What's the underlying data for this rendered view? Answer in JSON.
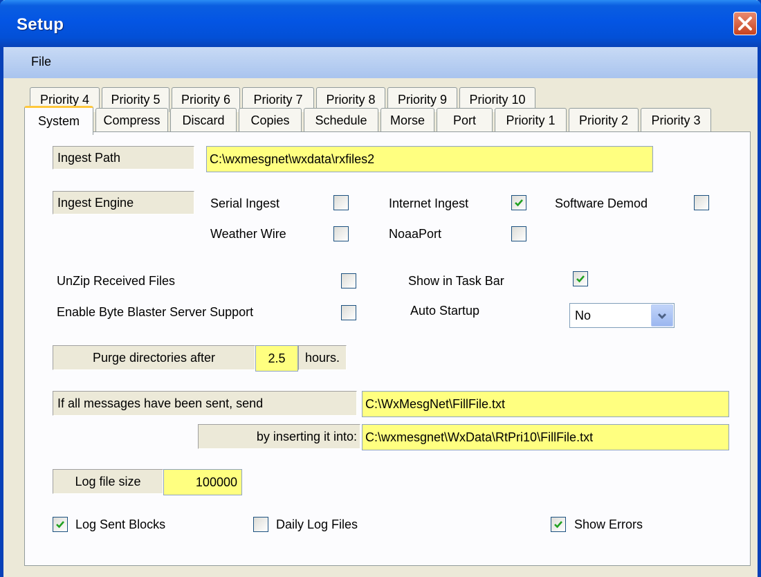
{
  "window": {
    "title": "Setup"
  },
  "menu": {
    "file": "File"
  },
  "tabs": {
    "row1": [
      "Priority 4",
      "Priority 5",
      "Priority 6",
      "Priority 7",
      "Priority 8",
      "Priority 9",
      "Priority 10"
    ],
    "row2": [
      "System",
      "Compress",
      "Discard",
      "Copies",
      "Schedule",
      "Morse",
      "Port",
      "Priority 1",
      "Priority 2",
      "Priority 3"
    ],
    "active": "System"
  },
  "system": {
    "ingest_path_label": "Ingest Path",
    "ingest_path_value": "C:\\wxmesgnet\\wxdata\\rxfiles2",
    "ingest_engine_label": "Ingest Engine",
    "serial_ingest": {
      "label": "Serial Ingest",
      "checked": false
    },
    "internet_ingest": {
      "label": "Internet Ingest",
      "checked": true
    },
    "software_demod": {
      "label": "Software Demod",
      "checked": false
    },
    "weather_wire": {
      "label": "Weather Wire",
      "checked": false
    },
    "noaaport": {
      "label": "NoaaPort",
      "checked": false
    },
    "unzip": {
      "label": "UnZip Received Files",
      "checked": false
    },
    "show_taskbar": {
      "label": "Show in Task Bar",
      "checked": true
    },
    "byte_blaster": {
      "label": "Enable Byte Blaster Server Support",
      "checked": false
    },
    "auto_startup": {
      "label": "Auto Startup",
      "value": "No"
    },
    "purge_label": "Purge directories after",
    "purge_value": "2.5",
    "purge_unit": "hours.",
    "fill_label": "If all messages have been sent, send",
    "fill_file": "C:\\WxMesgNet\\FillFile.txt",
    "insert_label": "by inserting it into:",
    "insert_file": "C:\\wxmesgnet\\WxData\\RtPri10\\FillFile.txt",
    "log_size_label": "Log file size",
    "log_size_value": "100000",
    "log_sent": {
      "label": "Log Sent Blocks",
      "checked": true
    },
    "daily_logs": {
      "label": "Daily Log Files",
      "checked": false
    },
    "show_errors": {
      "label": "Show Errors",
      "checked": true
    }
  }
}
